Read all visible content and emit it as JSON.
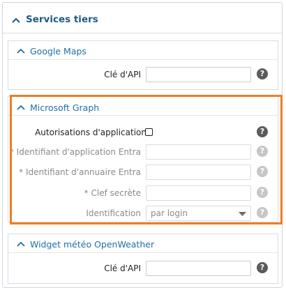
{
  "main": {
    "title": "Services tiers"
  },
  "google_maps": {
    "title": "Google Maps",
    "api_key_label": "Clé d'API",
    "api_key_value": "",
    "help": "?"
  },
  "microsoft_graph": {
    "title": "Microsoft Graph",
    "app_permissions_label": "Autorisations d'application",
    "app_permissions_checked": false,
    "app_id_label": "* Identifiant d'application Entra",
    "app_id_value": "",
    "directory_id_label": "* Identifiant d'annuaire Entra",
    "directory_id_value": "",
    "secret_label": "* Clef secrète",
    "secret_value": "",
    "identification_label": "Identification",
    "identification_value": "par login",
    "help": "?"
  },
  "openweather": {
    "title": "Widget météo OpenWeather",
    "api_key_label": "Clé d'API",
    "api_key_value": "",
    "help": "?"
  },
  "colors": {
    "highlight": "#ef7d22",
    "title_blue": "#1e5a88",
    "link_blue": "#1f6fa3"
  },
  "icons": [
    "chevron-up-icon",
    "help-icon",
    "caret-down-icon"
  ]
}
